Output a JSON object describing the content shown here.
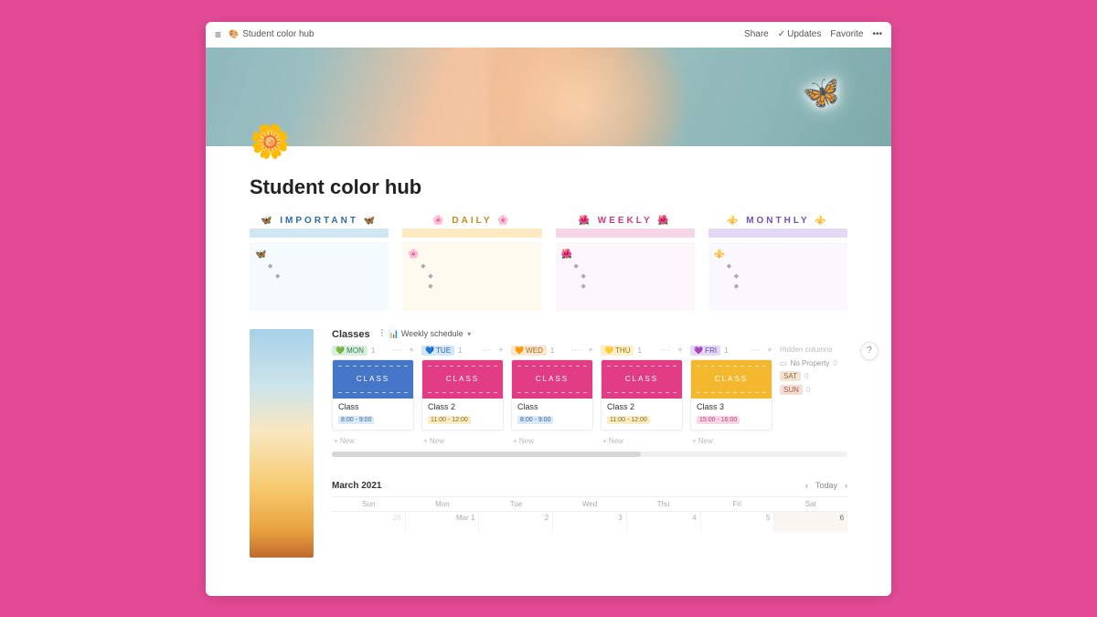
{
  "topbar": {
    "crumb_icon": "🎨",
    "page_title": "Student color hub",
    "share": "Share",
    "updates": "Updates",
    "favorite": "Favorite"
  },
  "page": {
    "icon": "🌼",
    "title": "Student color hub"
  },
  "sections": [
    {
      "key": "important",
      "label": "IMPORTANT",
      "lead_icon": "🦋",
      "dot": "◆"
    },
    {
      "key": "daily",
      "label": "DAILY",
      "lead_icon": "🌸",
      "dot": "◆"
    },
    {
      "key": "weekly",
      "label": "WEEKLY",
      "lead_icon": "🌺",
      "dot": "◆"
    },
    {
      "key": "monthly",
      "label": "MONTHLY",
      "lead_icon": "⚜️",
      "dot": "◆"
    }
  ],
  "classes": {
    "db_title": "Classes",
    "view_icon": "📊",
    "view_name": "Weekly schedule",
    "columns": [
      {
        "day": "MON",
        "heart": "💚",
        "tag": "tag-mon",
        "count": 1,
        "hero": "hero-blue",
        "hero_label": "CLASS",
        "card_title": "Class",
        "time": "8:00 - 9:00",
        "time_cls": "tt-blue"
      },
      {
        "day": "TUE",
        "heart": "💙",
        "tag": "tag-tue",
        "count": 1,
        "hero": "hero-pink",
        "hero_label": "CLASS",
        "card_title": "Class 2",
        "time": "11:00 - 12:00",
        "time_cls": "tt-yellow"
      },
      {
        "day": "WED",
        "heart": "🧡",
        "tag": "tag-wed",
        "count": 1,
        "hero": "hero-pink",
        "hero_label": "CLASS",
        "card_title": "Class",
        "time": "8:00 - 9:00",
        "time_cls": "tt-blue"
      },
      {
        "day": "THU",
        "heart": "💛",
        "tag": "tag-thu",
        "count": 1,
        "hero": "hero-pink",
        "hero_label": "CLASS",
        "card_title": "Class 2",
        "time": "11:00 - 12:00",
        "time_cls": "tt-yellow"
      },
      {
        "day": "FRI",
        "heart": "💜",
        "tag": "tag-fri",
        "count": 1,
        "hero": "hero-yell",
        "hero_label": "CLASS",
        "card_title": "Class 3",
        "time": "15:00 - 16:00",
        "time_cls": "tt-pink"
      }
    ],
    "new_label": "+  New",
    "hidden": {
      "title": "Hidden columns",
      "noprop_label": "No Property",
      "noprop_count": 0,
      "rows": [
        {
          "label": "SAT",
          "tag": "tag-sat",
          "count": 0
        },
        {
          "label": "SUN",
          "tag": "tag-sun",
          "count": 0
        }
      ]
    }
  },
  "calendar": {
    "month": "March 2021",
    "today_label": "Today",
    "days": [
      "Sun",
      "Mon",
      "Tue",
      "Wed",
      "Thu",
      "Fri",
      "Sat"
    ],
    "row": [
      "28",
      "Mar 1",
      "2",
      "3",
      "4",
      "5",
      "6"
    ],
    "dim_first": true,
    "today_index": 6
  },
  "help": "?"
}
